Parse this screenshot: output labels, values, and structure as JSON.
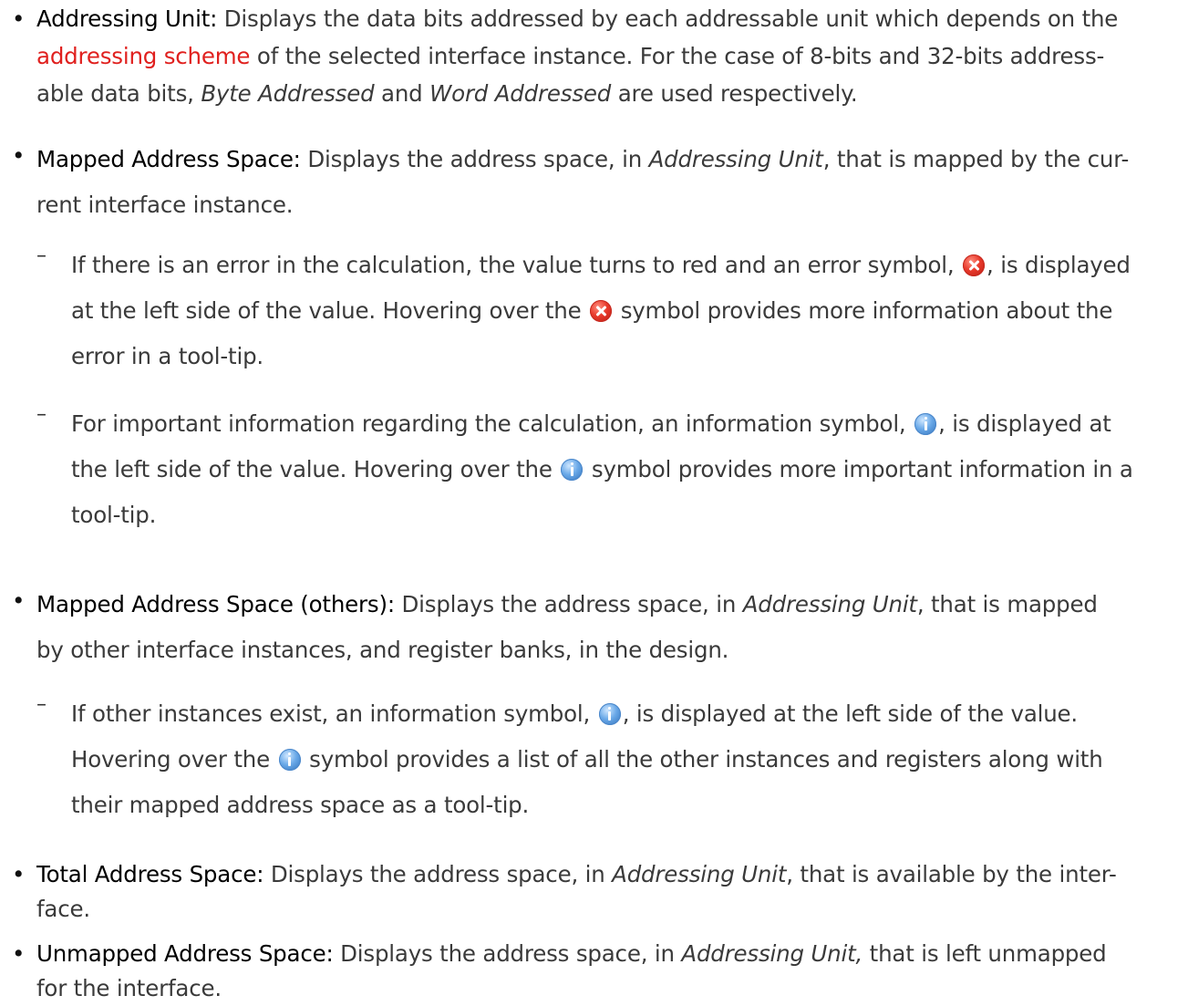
{
  "items": [
    {
      "term": "Addressing Unit:",
      "line1": " Displays the data bits addressed by each addressable unit which depends on the",
      "link": "addressing scheme",
      "line2_rest": " of the selected interface instance. For the case of 8-bits and 32-bits address-",
      "line3_a": "able data bits, ",
      "em1": "Byte Addressed",
      "line3_b": " and ",
      "em2": "Word Addressed",
      "line3_c": " are used respectively."
    },
    {
      "term": "Mapped Address Space:",
      "line1_a": " Displays the address space, in ",
      "em": "Addressing Unit",
      "line1_b": ",  that is mapped by the cur-",
      "line2": "rent interface instance."
    },
    {
      "term": "Mapped Address Space (others):",
      "line1_a": " Displays the address space, in ",
      "em": "Addressing Unit",
      "line1_b": ",  that is mapped",
      "line2": "by other interface instances, and register banks, in the design."
    },
    {
      "term": "Total Address Space:",
      "line1_a": " Displays the address space, in ",
      "em": "Addressing Unit",
      "line1_b": ", that is available by the inter-",
      "line2": "face."
    },
    {
      "term": "Unmapped Address Space:",
      "line1_a": " Displays the address space, in ",
      "em": "Addressing Unit,",
      "line1_b": "  that is left unmapped",
      "line2": "for the interface."
    }
  ],
  "subitems": [
    {
      "l1_a": "If there is an error in the calculation, the value turns to red and an error symbol, ",
      "l1_b": ", is displayed",
      "l2_a": "at the left side of the value. Hovering over the ",
      "l2_b": " symbol provides more information about the",
      "l3": "error in a tool-tip."
    },
    {
      "l1_a": "For important information regarding the calculation, an information symbol, ",
      "l1_b": ", is displayed at",
      "l2_a": "the left side of the value. Hovering over the ",
      "l2_b": " symbol provides more important information in a",
      "l3": "tool-tip."
    },
    {
      "l1_a": "If other instances exist, an information symbol, ",
      "l1_b": ", is displayed at the left side of the value.",
      "l2_a": "Hovering over the ",
      "l2_b": " symbol provides a list of all the other instances and registers along with",
      "l3": "their mapped address space as a tool-tip."
    }
  ],
  "bullet_char": "•",
  "dash_char": "–",
  "icons": {
    "error": "error-icon",
    "info": "info-icon"
  },
  "colors": {
    "link": "#e0201e",
    "text": "#3a3a3a",
    "term": "#000000"
  }
}
